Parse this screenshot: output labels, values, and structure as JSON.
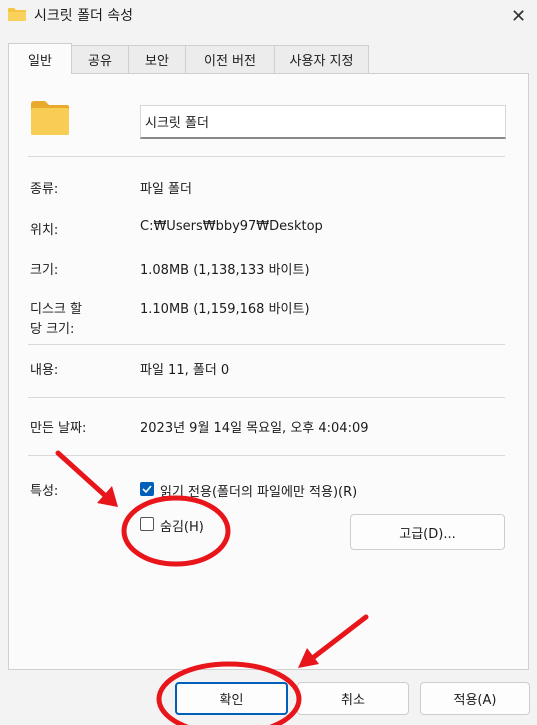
{
  "window": {
    "title": "시크릿 폴더 속성",
    "close_icon": "close-icon"
  },
  "tabs": [
    {
      "label": "일반",
      "active": true
    },
    {
      "label": "공유",
      "active": false
    },
    {
      "label": "보안",
      "active": false
    },
    {
      "label": "이전 버전",
      "active": false
    },
    {
      "label": "사용자 지정",
      "active": false
    }
  ],
  "general": {
    "folder_name": "시크릿 폴더",
    "type_label": "종류:",
    "type_value": "파일 폴더",
    "location_label": "위치:",
    "location_value": "C:₩Users₩bby97₩Desktop",
    "size_label": "크기:",
    "size_value": "1.08MB (1,138,133 바이트)",
    "disk_size_label_1": "디스크 할",
    "disk_size_label_2": "당 크기:",
    "disk_size_value": "1.10MB (1,159,168 바이트)",
    "contents_label": "내용:",
    "contents_value": "파일 11, 폴더 0",
    "created_label": "만든 날짜:",
    "created_value": "2023년 9월 14일 목요일, 오후 4:04:09",
    "attributes_label": "특성:",
    "readonly_label": "읽기 전용(폴더의 파일에만 적용)(R)",
    "readonly_checked": true,
    "hidden_label": "숨김(H)",
    "hidden_checked": false,
    "advanced_button": "고급(D)..."
  },
  "footer": {
    "ok_button": "확인",
    "cancel_button": "취소",
    "apply_button": "적용(A)"
  },
  "colors": {
    "accent": "#005fb8",
    "annotation": "#e8151b",
    "folder": "#f6c443"
  }
}
